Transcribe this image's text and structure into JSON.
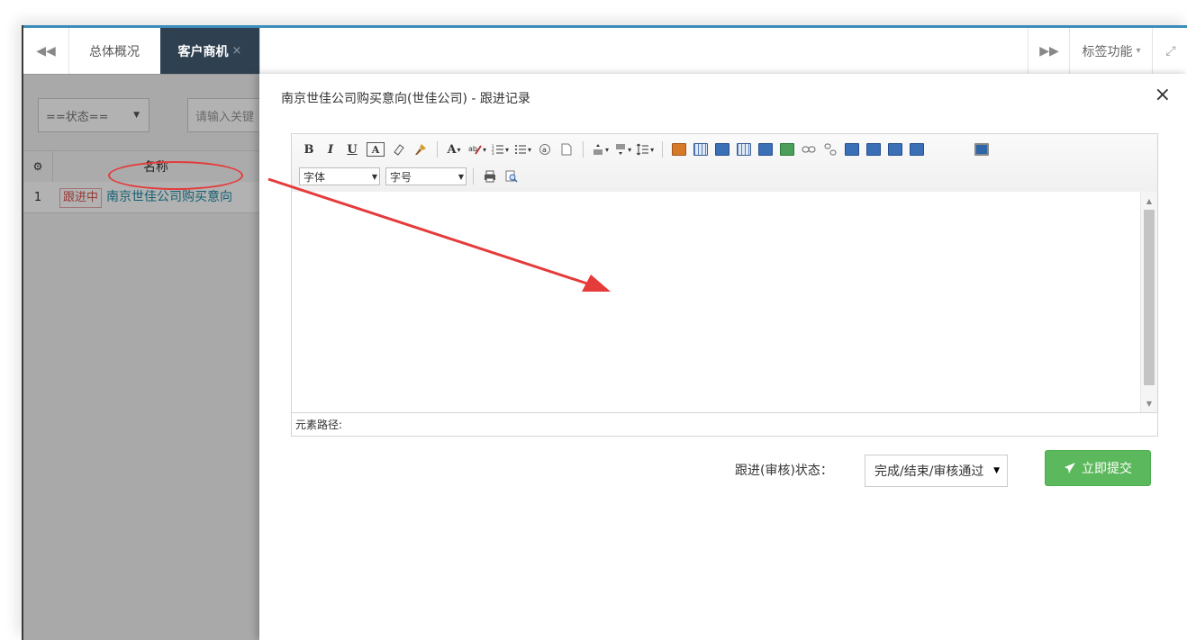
{
  "tabbar": {
    "nav_left": "◀◀",
    "tabs": [
      {
        "label": "总体概况"
      },
      {
        "label": "客户商机",
        "close": "×"
      }
    ],
    "nav_right": "▶▶",
    "tab_functions_label": "标签功能",
    "tab_functions_caret": "▾",
    "fullscreen": "⤢"
  },
  "list": {
    "status_filter": "==状态==",
    "keyword_placeholder": "请输入关键",
    "gear": "⚙",
    "header_name": "名称",
    "rows": [
      {
        "index": "1",
        "status_badge": "跟进中",
        "name": "南京世佳公司购买意向"
      }
    ]
  },
  "modal": {
    "title": "南京世佳公司购买意向(世佳公司) - 跟进记录",
    "close": "×",
    "editor": {
      "row1_text": {
        "bold": "B",
        "italic": "I",
        "underline": "U",
        "border": "A",
        "font_color": "A",
        "caret": "▾"
      },
      "font_family_label": "字体",
      "font_size_label": "字号",
      "element_path_label": "元素路径:",
      "scroll_up": "▲",
      "scroll_down": "▼"
    },
    "status_label": "跟进(审核)状态：",
    "status_value": "完成/结束/审核通过",
    "status_arrow": "▼",
    "submit_label": "立即提交"
  },
  "colors": {
    "accent": "#3c8dbc",
    "active_tab": "#2f4050",
    "submit": "#5cb85c",
    "annotation_red": "#e53b3b"
  }
}
